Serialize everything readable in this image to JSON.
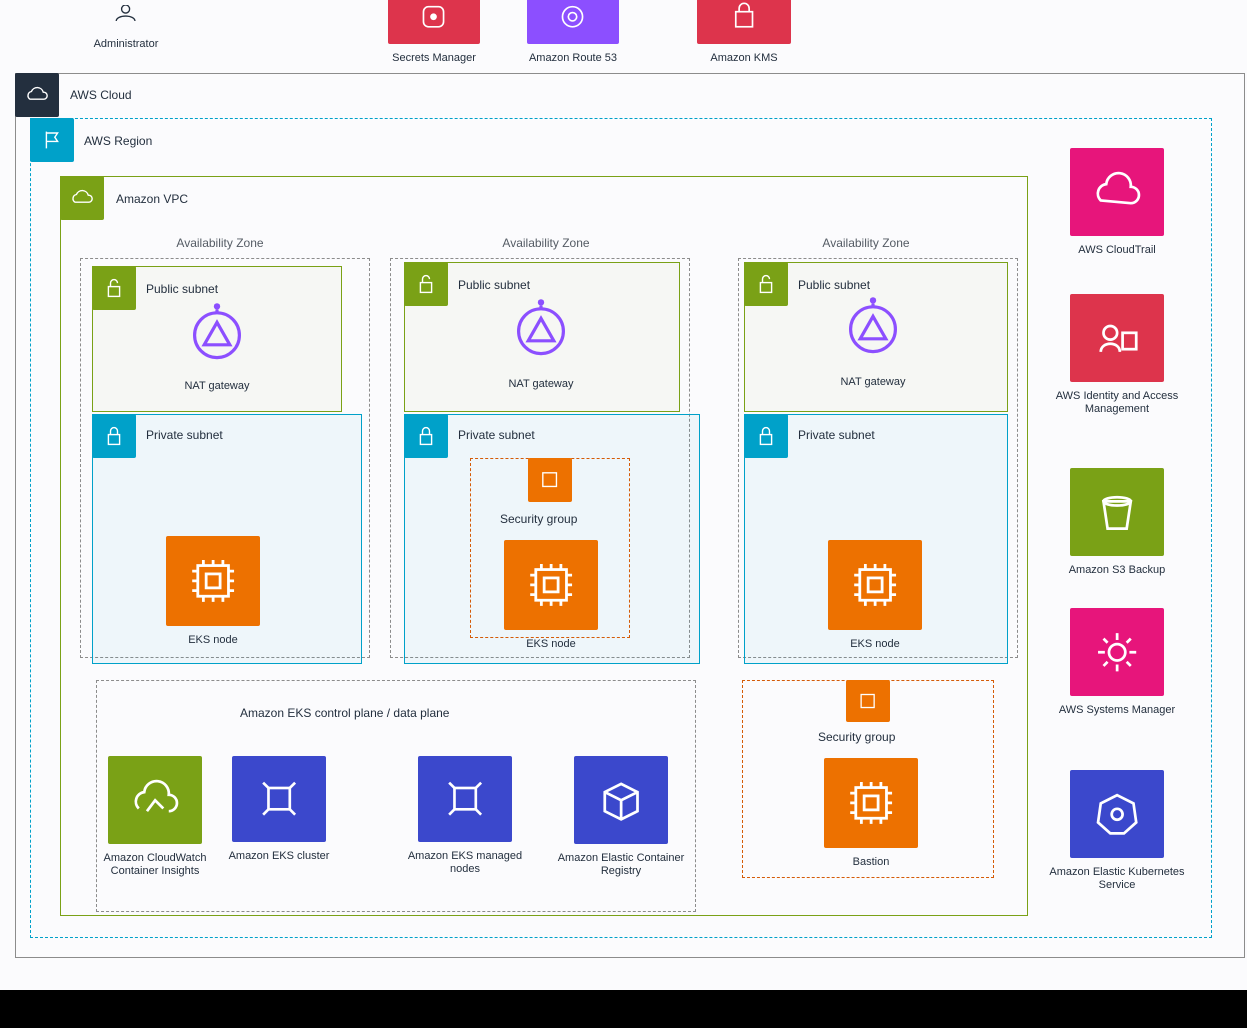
{
  "colors": {
    "compute": "#ed7100",
    "security": "#dd344c",
    "management": "#e7157b",
    "networking": "#8c4fff",
    "storage": "#7aa116",
    "containers": "#3b48cc",
    "vpc_green": "#7aa116",
    "subnet_blue": "#00a1c9"
  },
  "top_row": {
    "admin_label": "Administrator",
    "services": [
      {
        "label": "Secrets Manager",
        "icon": "key-icon"
      },
      {
        "label": "Amazon Route 53",
        "icon": "shield-icon"
      },
      {
        "label": "Amazon KMS",
        "icon": "lock-icon"
      }
    ]
  },
  "groups": {
    "aws_cloud": "AWS Cloud",
    "region": "AWS Region",
    "vpc": "Amazon VPC",
    "availability_zones": [
      "Availability Zone",
      "Availability Zone",
      "Availability Zone"
    ],
    "public_subnet": "Public subnet",
    "private_subnet": "Private subnet",
    "security_group": "Security group",
    "data_plane": "Amazon EKS control plane / data plane"
  },
  "nat_gateways": [
    "NAT gateway",
    "NAT gateway",
    "NAT gateway"
  ],
  "ec2_instances": [
    "EKS node",
    "EKS node",
    "EKS node",
    "Bastion"
  ],
  "eks_services": [
    {
      "label": "Amazon CloudWatch Container Insights",
      "icon": "cloudwatch-icon"
    },
    {
      "label": "Amazon EKS cluster",
      "icon": "eks-icon"
    },
    {
      "label": "Amazon EKS managed nodes",
      "icon": "eks-icon"
    },
    {
      "label": "Amazon Elastic Container Registry",
      "icon": "ecr-icon"
    }
  ],
  "right_column": [
    {
      "label": "AWS CloudTrail",
      "icon": "cloud-icon"
    },
    {
      "label": "AWS Identity and Access Management",
      "icon": "iam-icon"
    },
    {
      "label": "Amazon S3 Backup",
      "icon": "bucket-icon"
    },
    {
      "label": "AWS Systems Manager",
      "icon": "gear-icon"
    },
    {
      "label": "Amazon Elastic Kubernetes Service",
      "icon": "kubernetes-icon"
    }
  ]
}
